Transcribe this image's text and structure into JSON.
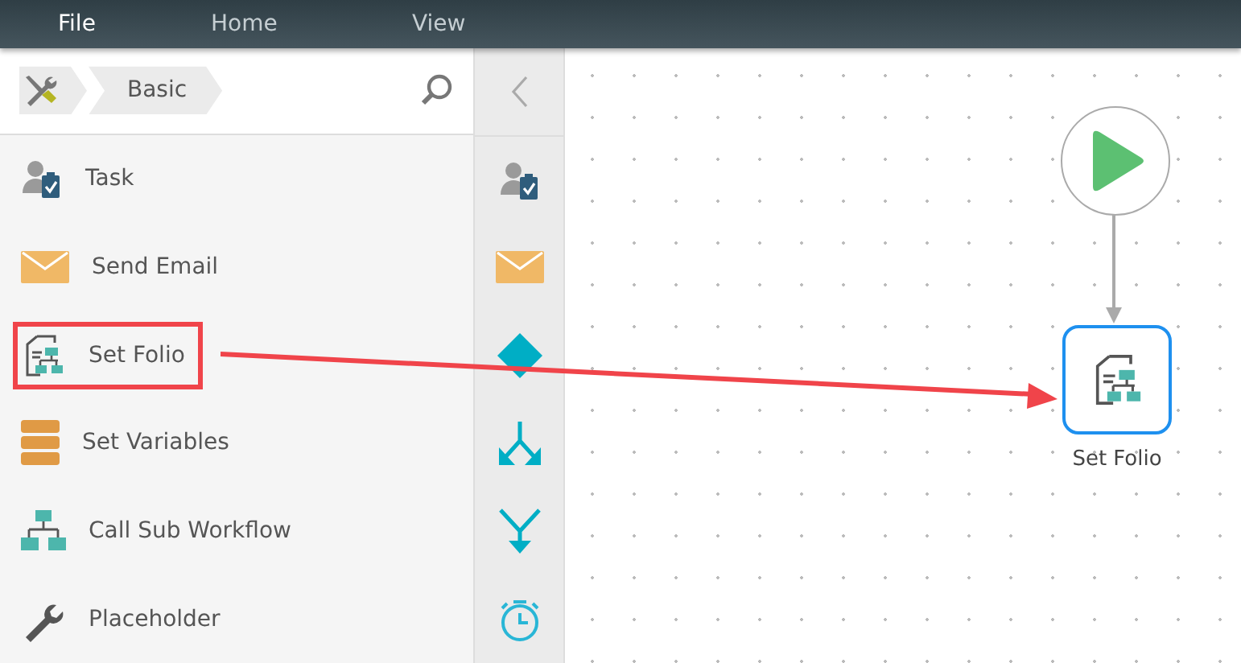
{
  "menu": [
    {
      "label": "File",
      "selected": true
    },
    {
      "label": "Home",
      "selected": false
    },
    {
      "label": "View",
      "selected": false
    }
  ],
  "breadcrumb": {
    "label": "Basic"
  },
  "toolbox": [
    {
      "label": "Task",
      "kind": "task",
      "highlighted": false
    },
    {
      "label": "Send Email",
      "kind": "email",
      "highlighted": false
    },
    {
      "label": "Set Folio",
      "kind": "folio",
      "highlighted": true
    },
    {
      "label": "Set Variables",
      "kind": "variables",
      "highlighted": false
    },
    {
      "label": "Call Sub Workflow",
      "kind": "subworkflow",
      "highlighted": false
    },
    {
      "label": "Placeholder",
      "kind": "placeholder",
      "highlighted": false
    }
  ],
  "strip": [
    {
      "kind": "task"
    },
    {
      "kind": "email"
    },
    {
      "kind": "decision"
    },
    {
      "kind": "split"
    },
    {
      "kind": "merge"
    },
    {
      "kind": "timer"
    }
  ],
  "canvas": {
    "nodes": [
      {
        "kind": "start"
      },
      {
        "kind": "folio",
        "label": "Set Folio",
        "selected": true
      }
    ]
  }
}
